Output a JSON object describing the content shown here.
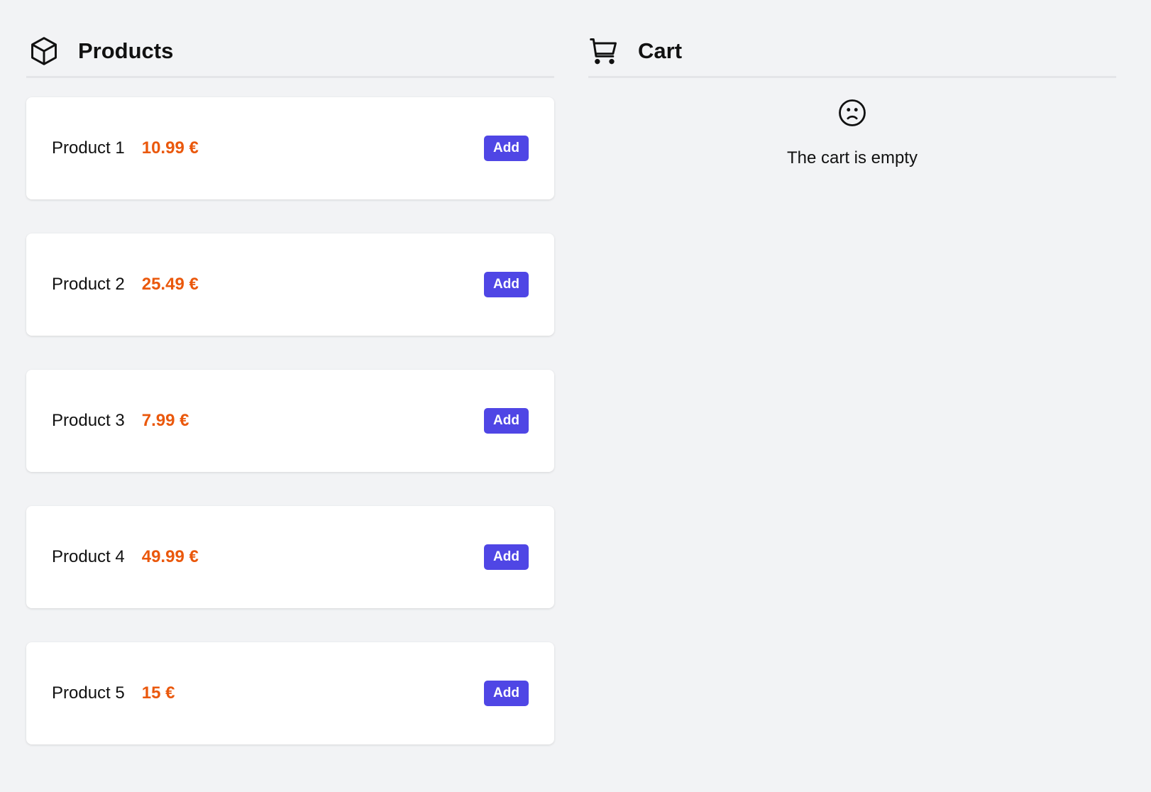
{
  "products": {
    "title": "Products",
    "icon": "cube-icon",
    "items": [
      {
        "name": "Product 1",
        "price": "10.99 €",
        "button": "Add"
      },
      {
        "name": "Product 2",
        "price": "25.49 €",
        "button": "Add"
      },
      {
        "name": "Product 3",
        "price": "7.99 €",
        "button": "Add"
      },
      {
        "name": "Product 4",
        "price": "49.99 €",
        "button": "Add"
      },
      {
        "name": "Product 5",
        "price": "15 €",
        "button": "Add"
      }
    ]
  },
  "cart": {
    "title": "Cart",
    "icon": "cart-icon",
    "empty_icon": "sad-face-icon",
    "empty_text": "The cart is empty"
  },
  "colors": {
    "price": "#ea580c",
    "button": "#4f46e5",
    "background": "#f2f3f5"
  }
}
